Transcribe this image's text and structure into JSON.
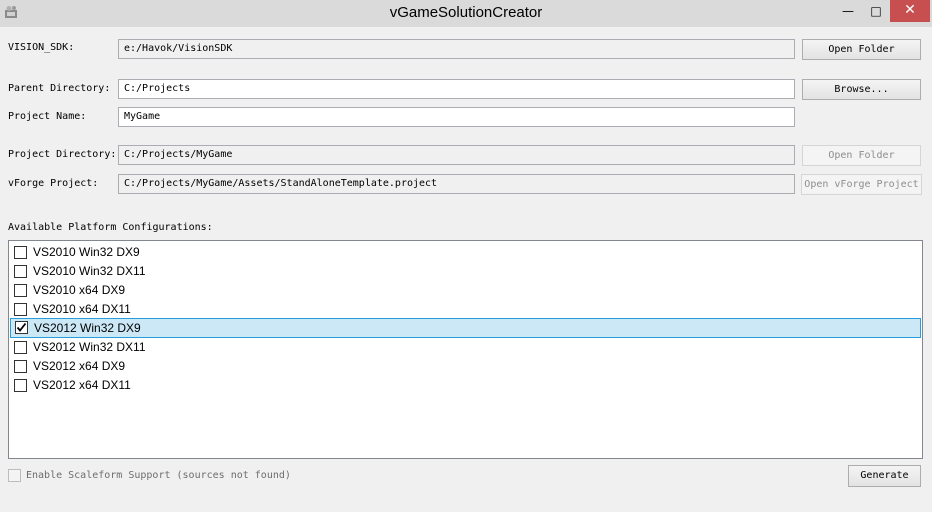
{
  "window": {
    "title": "vGameSolutionCreator",
    "min": "—",
    "max": "□",
    "close": "✕"
  },
  "form": {
    "vision_sdk": {
      "label": "VISION_SDK:",
      "value": "e:/Havok/VisionSDK",
      "button": "Open Folder"
    },
    "parent_dir": {
      "label": "Parent Directory:",
      "value": "C:/Projects",
      "button": "Browse..."
    },
    "project_name": {
      "label": "Project Name:",
      "value": "MyGame"
    },
    "project_dir": {
      "label": "Project Directory:",
      "value": "C:/Projects/MyGame",
      "button": "Open Folder"
    },
    "vforge_project": {
      "label": "vForge Project:",
      "value": "C:/Projects/MyGame/Assets/StandAloneTemplate.project",
      "button": "Open vForge Project"
    }
  },
  "platforms": {
    "label": "Available Platform Configurations:",
    "items": [
      {
        "label": "VS2010 Win32 DX9",
        "checked": false
      },
      {
        "label": "VS2010 Win32 DX11",
        "checked": false
      },
      {
        "label": "VS2010 x64 DX9",
        "checked": false
      },
      {
        "label": "VS2010 x64 DX11",
        "checked": false
      },
      {
        "label": "VS2012 Win32 DX9",
        "checked": true,
        "selected": true
      },
      {
        "label": "VS2012 Win32 DX11",
        "checked": false
      },
      {
        "label": "VS2012 x64 DX9",
        "checked": false
      },
      {
        "label": "VS2012 x64 DX11",
        "checked": false
      }
    ]
  },
  "scaleform": {
    "label": "Enable Scaleform Support (sources not found)",
    "enabled": false,
    "checked": false
  },
  "actions": {
    "generate": "Generate"
  }
}
